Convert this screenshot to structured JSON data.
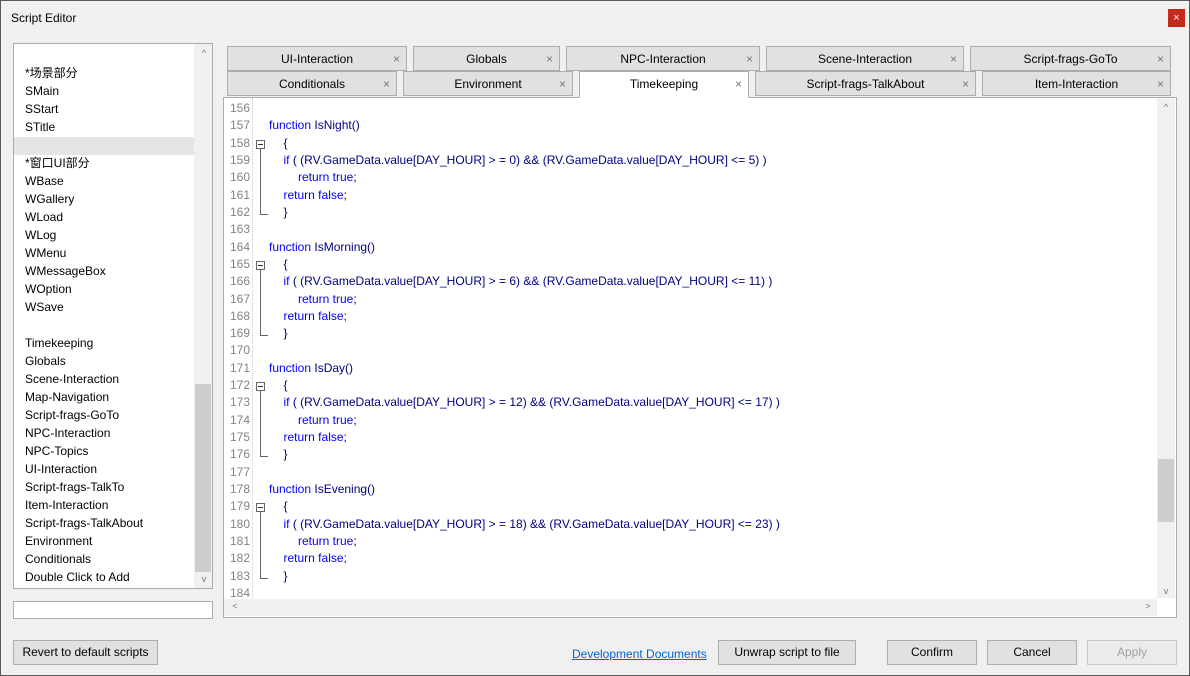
{
  "window": {
    "title": "Script Editor",
    "close_label": "×"
  },
  "list_items": [
    {
      "label": "*场景部分",
      "row": 0
    },
    {
      "label": "SMain",
      "row": 1
    },
    {
      "label": "SStart",
      "row": 2
    },
    {
      "label": "STitle",
      "row": 3
    },
    {
      "label": "",
      "row": 4,
      "selected": true
    },
    {
      "label": "*窗口UI部分",
      "row": 5
    },
    {
      "label": "WBase",
      "row": 6
    },
    {
      "label": "WGallery",
      "row": 7
    },
    {
      "label": "WLoad",
      "row": 8
    },
    {
      "label": "WLog",
      "row": 9
    },
    {
      "label": "WMenu",
      "row": 10
    },
    {
      "label": "WMessageBox",
      "row": 11
    },
    {
      "label": "WOption",
      "row": 12
    },
    {
      "label": "WSave",
      "row": 13
    },
    {
      "label": "Timekeeping",
      "row": 15
    },
    {
      "label": "Globals",
      "row": 16
    },
    {
      "label": "Scene-Interaction",
      "row": 17
    },
    {
      "label": "Map-Navigation",
      "row": 18
    },
    {
      "label": "Script-frags-GoTo",
      "row": 19
    },
    {
      "label": "NPC-Interaction",
      "row": 20
    },
    {
      "label": "NPC-Topics",
      "row": 21
    },
    {
      "label": "UI-Interaction",
      "row": 22
    },
    {
      "label": "Script-frags-TalkTo",
      "row": 23
    },
    {
      "label": "Item-Interaction",
      "row": 24
    },
    {
      "label": "Script-frags-TalkAbout",
      "row": 25
    },
    {
      "label": "Environment",
      "row": 26
    },
    {
      "label": "Conditionals",
      "row": 27
    },
    {
      "label": "Double Click to Add",
      "row": 28
    }
  ],
  "script_name_input": {
    "value": ""
  },
  "tabs_row1": [
    {
      "label": "UI-Interaction"
    },
    {
      "label": "Globals"
    },
    {
      "label": "NPC-Interaction"
    },
    {
      "label": "Scene-Interaction"
    },
    {
      "label": "Script-frags-GoTo"
    }
  ],
  "tabs_row2": [
    {
      "label": "Conditionals"
    },
    {
      "label": "Environment"
    },
    {
      "label": "Timekeeping",
      "active": true
    },
    {
      "label": "Script-frags-TalkAbout"
    },
    {
      "label": "Item-Interaction"
    }
  ],
  "tab_close": "×",
  "code_lines": [
    {
      "n": "156",
      "indent": 0,
      "tokens": []
    },
    {
      "n": "157",
      "indent": 0,
      "tokens": [
        {
          "k": 1,
          "v": "function"
        },
        {
          "k": 0,
          "v": " IsNight()"
        }
      ]
    },
    {
      "n": "158",
      "indent": 1,
      "fold": "start",
      "tokens": [
        {
          "k": 0,
          "v": "{"
        }
      ]
    },
    {
      "n": "159",
      "indent": 1,
      "tokens": [
        {
          "k": 1,
          "v": "if"
        },
        {
          "k": 0,
          "v": " ( (RV.GameData.value[DAY_HOUR] > = 0) && (RV.GameData.value[DAY_HOUR] <= 5) )"
        }
      ]
    },
    {
      "n": "160",
      "indent": 2,
      "tokens": [
        {
          "k": 1,
          "v": "return true"
        },
        {
          "k": 0,
          "v": ";"
        }
      ]
    },
    {
      "n": "161",
      "indent": 1,
      "tokens": [
        {
          "k": 1,
          "v": "return false"
        },
        {
          "k": 0,
          "v": ";"
        }
      ]
    },
    {
      "n": "162",
      "indent": 1,
      "fold": "end",
      "tokens": [
        {
          "k": 0,
          "v": "}"
        }
      ]
    },
    {
      "n": "163",
      "indent": 0,
      "tokens": []
    },
    {
      "n": "164",
      "indent": 0,
      "tokens": [
        {
          "k": 1,
          "v": "function"
        },
        {
          "k": 0,
          "v": " IsMorning()"
        }
      ]
    },
    {
      "n": "165",
      "indent": 1,
      "fold": "start",
      "tokens": [
        {
          "k": 0,
          "v": "{"
        }
      ]
    },
    {
      "n": "166",
      "indent": 1,
      "tokens": [
        {
          "k": 1,
          "v": "if"
        },
        {
          "k": 0,
          "v": " ( (RV.GameData.value[DAY_HOUR] > = 6) && (RV.GameData.value[DAY_HOUR] <= 11) )"
        }
      ]
    },
    {
      "n": "167",
      "indent": 2,
      "tokens": [
        {
          "k": 1,
          "v": "return true"
        },
        {
          "k": 0,
          "v": ";"
        }
      ]
    },
    {
      "n": "168",
      "indent": 1,
      "tokens": [
        {
          "k": 1,
          "v": "return false"
        },
        {
          "k": 0,
          "v": ";"
        }
      ]
    },
    {
      "n": "169",
      "indent": 1,
      "fold": "end",
      "tokens": [
        {
          "k": 0,
          "v": "}"
        }
      ]
    },
    {
      "n": "170",
      "indent": 0,
      "tokens": []
    },
    {
      "n": "171",
      "indent": 0,
      "tokens": [
        {
          "k": 1,
          "v": "function"
        },
        {
          "k": 0,
          "v": " IsDay()"
        }
      ]
    },
    {
      "n": "172",
      "indent": 1,
      "fold": "start",
      "tokens": [
        {
          "k": 0,
          "v": "{"
        }
      ]
    },
    {
      "n": "173",
      "indent": 1,
      "tokens": [
        {
          "k": 1,
          "v": "if"
        },
        {
          "k": 0,
          "v": " ( (RV.GameData.value[DAY_HOUR] > = 12) && (RV.GameData.value[DAY_HOUR] <= 17) )"
        }
      ]
    },
    {
      "n": "174",
      "indent": 2,
      "tokens": [
        {
          "k": 1,
          "v": "return true"
        },
        {
          "k": 0,
          "v": ";"
        }
      ]
    },
    {
      "n": "175",
      "indent": 1,
      "tokens": [
        {
          "k": 1,
          "v": "return false"
        },
        {
          "k": 0,
          "v": ";"
        }
      ]
    },
    {
      "n": "176",
      "indent": 1,
      "fold": "end",
      "tokens": [
        {
          "k": 0,
          "v": "}"
        }
      ]
    },
    {
      "n": "177",
      "indent": 0,
      "tokens": []
    },
    {
      "n": "178",
      "indent": 0,
      "tokens": [
        {
          "k": 1,
          "v": "function"
        },
        {
          "k": 0,
          "v": " IsEvening()"
        }
      ]
    },
    {
      "n": "179",
      "indent": 1,
      "fold": "start",
      "tokens": [
        {
          "k": 0,
          "v": "{"
        }
      ]
    },
    {
      "n": "180",
      "indent": 1,
      "tokens": [
        {
          "k": 1,
          "v": "if"
        },
        {
          "k": 0,
          "v": " ( (RV.GameData.value[DAY_HOUR] > = 18) && (RV.GameData.value[DAY_HOUR] <= 23) )"
        }
      ]
    },
    {
      "n": "181",
      "indent": 2,
      "tokens": [
        {
          "k": 1,
          "v": "return true"
        },
        {
          "k": 0,
          "v": ";"
        }
      ]
    },
    {
      "n": "182",
      "indent": 1,
      "tokens": [
        {
          "k": 1,
          "v": "return false"
        },
        {
          "k": 0,
          "v": ";"
        }
      ]
    },
    {
      "n": "183",
      "indent": 1,
      "fold": "end",
      "tokens": [
        {
          "k": 0,
          "v": "}"
        }
      ]
    },
    {
      "n": "184",
      "indent": 0,
      "tokens": []
    }
  ],
  "footer": {
    "revert": "Revert to default scripts",
    "dev_docs": "Development Documents",
    "unwrap": "Unwrap script to file",
    "confirm": "Confirm",
    "cancel": "Cancel",
    "apply": "Apply"
  },
  "scroll_arrows": {
    "up": "^",
    "down": "v",
    "left": "<",
    "right": ">"
  }
}
